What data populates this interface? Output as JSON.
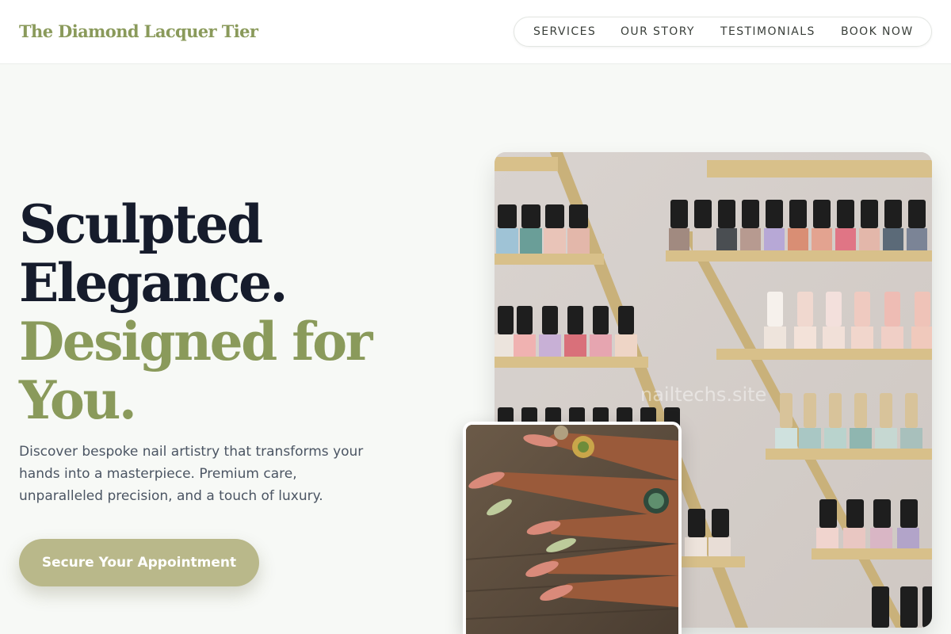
{
  "brand": {
    "name": "The Diamond Lacquer Tier"
  },
  "nav": [
    {
      "label": "SERVICES"
    },
    {
      "label": "OUR STORY"
    },
    {
      "label": "TESTIMONIALS"
    },
    {
      "label": "BOOK NOW"
    }
  ],
  "hero": {
    "headline_dark_1": "Sculpted",
    "headline_dark_2": "Elegance.",
    "headline_accent_1": "Designed for",
    "headline_accent_2": "You.",
    "description": "Discover bespoke nail artistry that transforms your hands into a masterpiece. Premium care, unparalleled precision, and a touch of luxury.",
    "cta_label": "Secure Your Appointment"
  },
  "images": {
    "main_watermark": "nailtechs.site"
  },
  "colors": {
    "accent": "#8a9a5b",
    "dark": "#161c2c",
    "cta": "#b9b88a",
    "background": "#f7f9f6"
  }
}
